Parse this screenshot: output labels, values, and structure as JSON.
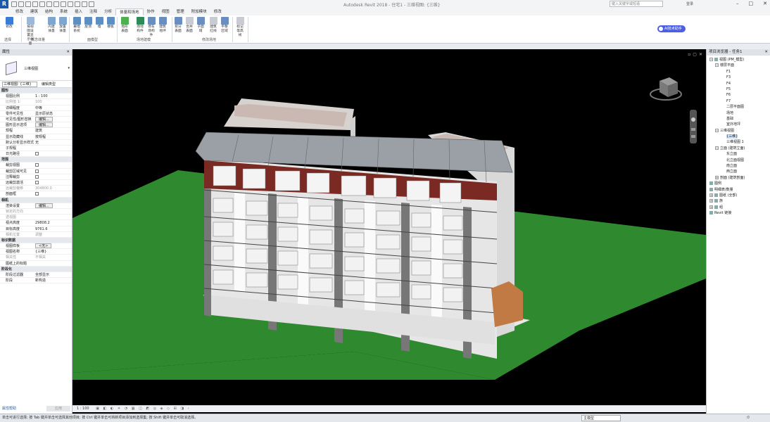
{
  "app": {
    "logo": "R",
    "title": "Autodesk Revit 2018 -    住宅1 - 三维视图: {三维}",
    "search_placeholder": "键入关键字或短语",
    "user": "登录",
    "ai_button": "AI技术助手"
  },
  "tabs": [
    "修改",
    "建筑",
    "结构",
    "系统",
    "插入",
    "注释",
    "分析",
    "体量和场地",
    "协作",
    "视图",
    "管理",
    "附加模块",
    "修改"
  ],
  "active_tab": 7,
  "ribbon": {
    "buttons": [
      {
        "label": "修改",
        "color": "#3a7bd5"
      },
      {
        "label": "按视图设置显示体量",
        "color": "#9cb8d8"
      },
      {
        "label": "内建体量",
        "color": "#7ea6cf"
      },
      {
        "label": "放置体量",
        "color": "#7ea6cf"
      },
      {
        "label": "幕墙系统",
        "color": "#5f8fc0"
      },
      {
        "label": "屋顶",
        "color": "#5f8fc0"
      },
      {
        "label": "墙",
        "color": "#5f8fc0"
      },
      {
        "label": "楼板",
        "color": "#5f8fc0"
      },
      {
        "label": "地形表面",
        "color": "#4caf50"
      },
      {
        "label": "场地构件",
        "color": "#2e8b57"
      },
      {
        "label": "停车场构件",
        "color": "#6b8ec0"
      },
      {
        "label": "建筑地坪",
        "color": "#6b8ec0"
      },
      {
        "label": "拆分表面",
        "color": "#6b8ec0"
      },
      {
        "label": "合并表面",
        "color": "#c8ccd2"
      },
      {
        "label": "子面域",
        "color": "#6b8ec0"
      },
      {
        "label": "建筑红线",
        "color": "#c8ccd2"
      },
      {
        "label": "平整区域",
        "color": "#6b8ec0"
      },
      {
        "label": "标记等高线",
        "color": "#c8ccd2"
      }
    ],
    "groups": [
      "选择",
      "概念体量",
      "面模型",
      "场地建模",
      "修改场地"
    ]
  },
  "properties": {
    "title": "属性",
    "type_name": "三维视图",
    "selector": "三维视图: {三维}",
    "edit_type": "编辑类型",
    "rows": [
      {
        "k": "图形",
        "v": "",
        "kind": "grp"
      },
      {
        "k": "视图比例",
        "v": "1 : 100",
        "kind": ""
      },
      {
        "k": "比例值 1:",
        "v": "100",
        "kind": "grey"
      },
      {
        "k": "详细程度",
        "v": "中等",
        "kind": ""
      },
      {
        "k": "零件可见性",
        "v": "显示原状态",
        "kind": ""
      },
      {
        "k": "可见性/图形替换",
        "v": "编辑...",
        "kind": "btn"
      },
      {
        "k": "图形显示选项",
        "v": "编辑...",
        "kind": "btn"
      },
      {
        "k": "规程",
        "v": "建筑",
        "kind": ""
      },
      {
        "k": "显示隐藏线",
        "v": "按规程",
        "kind": ""
      },
      {
        "k": "默认分析显示样式",
        "v": "无",
        "kind": ""
      },
      {
        "k": "子规程",
        "v": "",
        "kind": ""
      },
      {
        "k": "日光路径",
        "v": "",
        "kind": "chk"
      },
      {
        "k": "范围",
        "v": "",
        "kind": "grp"
      },
      {
        "k": "裁剪视图",
        "v": "",
        "kind": "chk"
      },
      {
        "k": "裁剪区域可见",
        "v": "",
        "kind": "chk"
      },
      {
        "k": "注释裁剪",
        "v": "",
        "kind": "chk"
      },
      {
        "k": "远裁剪激活",
        "v": "",
        "kind": "chk"
      },
      {
        "k": "远裁剪偏移",
        "v": "304800.0",
        "kind": "grey"
      },
      {
        "k": "剖面框",
        "v": "",
        "kind": "chk"
      },
      {
        "k": "相机",
        "v": "",
        "kind": "grp"
      },
      {
        "k": "渲染设置",
        "v": "编辑...",
        "kind": "btn"
      },
      {
        "k": "锁定的方向",
        "v": "",
        "kind": "grey"
      },
      {
        "k": "透视图",
        "v": "",
        "kind": "grey"
      },
      {
        "k": "视点高度",
        "v": "29808.2",
        "kind": ""
      },
      {
        "k": "目标高度",
        "v": "9761.6",
        "kind": ""
      },
      {
        "k": "相机位置",
        "v": "调整",
        "kind": "grey"
      },
      {
        "k": "标识数据",
        "v": "",
        "kind": "grp"
      },
      {
        "k": "视图样板",
        "v": "<无>",
        "kind": "btn"
      },
      {
        "k": "视图名称",
        "v": "{三维}",
        "kind": ""
      },
      {
        "k": "相关性",
        "v": "不相关",
        "kind": "grey"
      },
      {
        "k": "图纸上的标题",
        "v": "",
        "kind": ""
      },
      {
        "k": "阶段化",
        "v": "",
        "kind": "grp"
      },
      {
        "k": "阶段过滤器",
        "v": "全部显示",
        "kind": ""
      },
      {
        "k": "阶段",
        "v": "新构造",
        "kind": ""
      }
    ],
    "help_link": "属性帮助",
    "apply": "应用"
  },
  "viewbar": {
    "scale": "1 : 100"
  },
  "browser": {
    "title": "项目浏览器 - 任务1",
    "nodes": [
      {
        "label": "视图 (PM_模型)",
        "lvl": 0,
        "tg": "-",
        "ic": true
      },
      {
        "label": "楼层平面",
        "lvl": 1,
        "tg": "-"
      },
      {
        "label": "F1",
        "lvl": 3
      },
      {
        "label": "F3",
        "lvl": 3
      },
      {
        "label": "F4",
        "lvl": 3
      },
      {
        "label": "F5",
        "lvl": 3
      },
      {
        "label": "F6",
        "lvl": 3
      },
      {
        "label": "F7",
        "lvl": 3
      },
      {
        "label": "二层平面图",
        "lvl": 3
      },
      {
        "label": "场地",
        "lvl": 3
      },
      {
        "label": "基础",
        "lvl": 3
      },
      {
        "label": "室外地坪",
        "lvl": 3
      },
      {
        "label": "三维视图",
        "lvl": 1,
        "tg": "-"
      },
      {
        "label": "{三维}",
        "lvl": 3,
        "sel": true
      },
      {
        "label": "三维视图 1",
        "lvl": 3
      },
      {
        "label": "立面 (建筑立面)",
        "lvl": 1,
        "tg": "-"
      },
      {
        "label": "东立面",
        "lvl": 3
      },
      {
        "label": "北立面视图",
        "lvl": 3
      },
      {
        "label": "南立面",
        "lvl": 3
      },
      {
        "label": "西立面",
        "lvl": 3
      },
      {
        "label": "剖面 (建筑剖面)",
        "lvl": 1,
        "tg": "+"
      },
      {
        "label": "图例",
        "lvl": 0,
        "ic": true
      },
      {
        "label": "明细表/数量",
        "lvl": 0,
        "ic": true
      },
      {
        "label": "图纸 (全部)",
        "lvl": 0,
        "tg": "+",
        "ic": true
      },
      {
        "label": "族",
        "lvl": 0,
        "tg": "+",
        "ic": true
      },
      {
        "label": "组",
        "lvl": 0,
        "tg": "+",
        "ic": true
      },
      {
        "label": "Revit 链接",
        "lvl": 0,
        "ic": true
      }
    ]
  },
  "status": {
    "text": "单击可进行选择; 按 Tab 键并单击可选择其他项目; 按 Ctrl 键并单击可将新项目添加到选择集; 按 Shift 键并单击可取消选择。",
    "model": "主模型",
    "zoom": ":0"
  }
}
